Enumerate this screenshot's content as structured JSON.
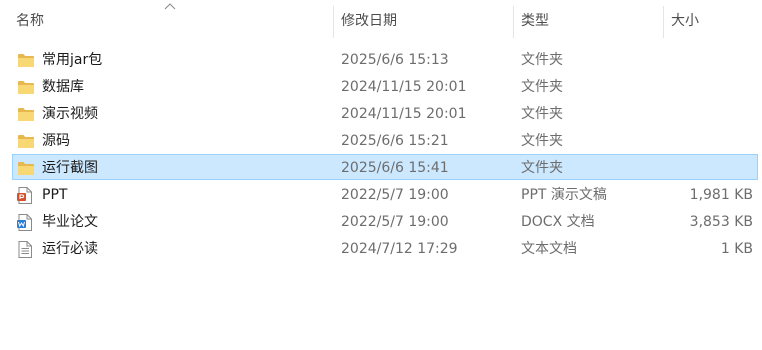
{
  "columns": {
    "name": "名称",
    "modified": "修改日期",
    "type": "类型",
    "size": "大小"
  },
  "rows": [
    {
      "name": "常用jar包",
      "modified": "2025/6/6 15:13",
      "type": "文件夹",
      "size": "",
      "icon": "folder-icon"
    },
    {
      "name": "数据库",
      "modified": "2024/11/15 20:01",
      "type": "文件夹",
      "size": "",
      "icon": "folder-icon"
    },
    {
      "name": "演示视频",
      "modified": "2024/11/15 20:01",
      "type": "文件夹",
      "size": "",
      "icon": "folder-icon"
    },
    {
      "name": "源码",
      "modified": "2025/6/6 15:21",
      "type": "文件夹",
      "size": "",
      "icon": "folder-icon"
    },
    {
      "name": "运行截图",
      "modified": "2025/6/6 15:41",
      "type": "文件夹",
      "size": "",
      "icon": "folder-icon",
      "selected": true
    },
    {
      "name": "PPT",
      "modified": "2022/5/7 19:00",
      "type": "PPT 演示文稿",
      "size": "1,981 KB",
      "icon": "powerpoint-file-icon"
    },
    {
      "name": "毕业论文",
      "modified": "2022/5/7 19:00",
      "type": "DOCX 文档",
      "size": "3,853 KB",
      "icon": "word-file-icon"
    },
    {
      "name": "运行必读",
      "modified": "2024/7/12 17:29",
      "type": "文本文档",
      "size": "1 KB",
      "icon": "text-file-icon"
    }
  ],
  "colors": {
    "selected_bg": "#cce8ff",
    "selected_border": "#99d1ff",
    "folder": "#f8d775"
  }
}
